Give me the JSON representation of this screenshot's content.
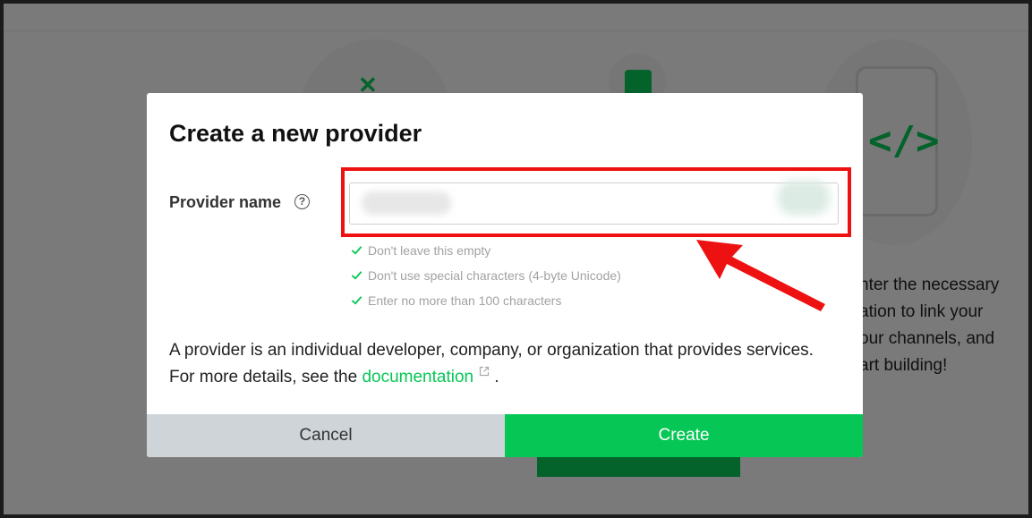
{
  "background": {
    "side_text": "nter the necessary\nation to link your\nour channels, and\nart building!",
    "code_glyph": "</>",
    "sparkle_glyph": "✕"
  },
  "modal": {
    "title": "Create a new provider",
    "field_label": "Provider name",
    "help_glyph": "?",
    "input_value": "",
    "rules": [
      "Don't leave this empty",
      "Don't use special characters (4-byte Unicode)",
      "Enter no more than 100 characters"
    ],
    "description_before": "A provider is an individual developer, company, or organization that provides services. For more details, see the ",
    "link_text": "documentation",
    "description_after": " .",
    "cancel_label": "Cancel",
    "create_label": "Create"
  },
  "colors": {
    "accent": "#06c755",
    "cancel_bg": "#cfd4d8",
    "annotation": "#ee1111"
  }
}
